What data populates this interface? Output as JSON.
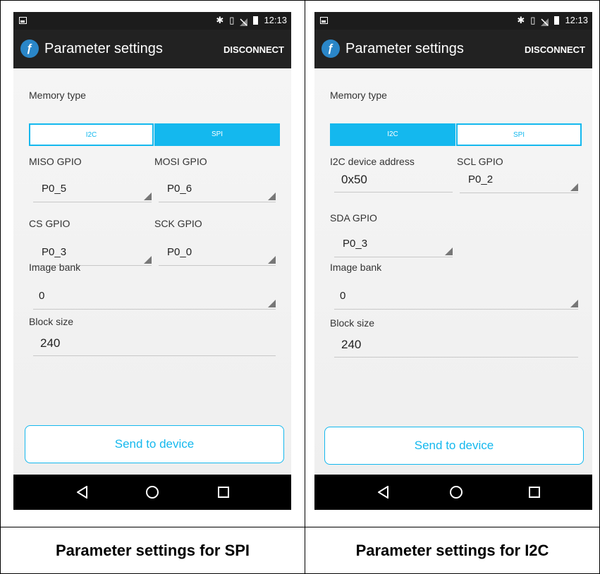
{
  "spi": {
    "status_time": "12:13",
    "app_title": "Parameter settings",
    "disconnect_label": "DISCONNECT",
    "memory_type_label": "Memory type",
    "seg_i2c": "I2C",
    "seg_spi": "SPI",
    "selected": "SPI",
    "miso_label": "MISO GPIO",
    "miso_value": "P0_5",
    "mosi_label": "MOSI GPIO",
    "mosi_value": "P0_6",
    "cs_label": "CS GPIO",
    "cs_value": "P0_3",
    "sck_label": "SCK GPIO",
    "sck_value": "P0_0",
    "image_bank_label": "Image bank",
    "image_bank_value": "0",
    "block_size_label": "Block size",
    "block_size_value": "240",
    "send_label": "Send to device"
  },
  "i2c": {
    "status_time": "12:13",
    "app_title": "Parameter settings",
    "disconnect_label": "DISCONNECT",
    "memory_type_label": "Memory type",
    "seg_i2c": "I2C",
    "seg_spi": "SPI",
    "selected": "I2C",
    "addr_label": "I2C device address",
    "addr_value": "0x50",
    "scl_label": "SCL GPIO",
    "scl_value": "P0_2",
    "sda_label": "SDA GPIO",
    "sda_value": "P0_3",
    "image_bank_label": "Image bank",
    "image_bank_value": "0",
    "block_size_label": "Block size",
    "block_size_value": "240",
    "send_label": "Send to device"
  },
  "captions": {
    "left": "Parameter settings for SPI",
    "right": "Parameter settings for I2C"
  },
  "colors": {
    "accent": "#14b8ee",
    "appbar": "#222222",
    "statusbar": "#1c1c1c",
    "navbar": "#000000"
  },
  "icons": {
    "logo": "app-logo-icon",
    "back": "back-triangle-icon",
    "home": "home-circle-icon",
    "recents": "recents-square-icon"
  }
}
